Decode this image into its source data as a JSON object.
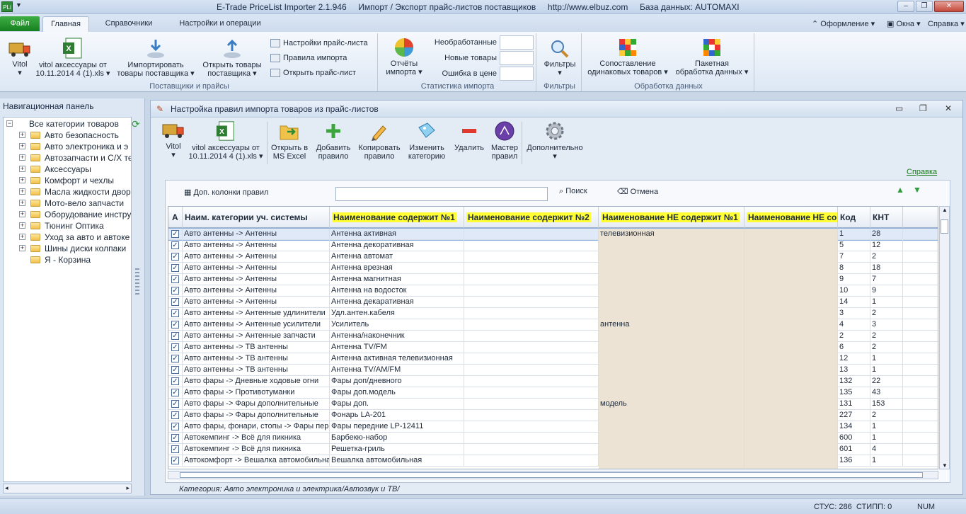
{
  "titlebar": {
    "app_icon": "PLi",
    "title": "E-Trade PriceList Importer 2.1.946     Импорт / Экспорт прайс-листов поставщиков     http://www.elbuz.com     База данных: AUTOMAXI"
  },
  "tabs": {
    "file": "Файл",
    "items": [
      "Главная",
      "Справочники",
      "Настройки и операции"
    ],
    "right": [
      "Оформление",
      "Окна",
      "Справка"
    ]
  },
  "ribbon": {
    "vitol": "Vitol",
    "file_name_1": "vitol аксессуары от",
    "file_name_2": "10.11.2014 4 (1).xls",
    "import_1": "Импортировать",
    "import_2": "товары поставщика",
    "open_1": "Открыть товары",
    "open_2": "поставщика",
    "settings_price": "Настройки прайс-листа",
    "import_rules": "Правила импорта",
    "open_price": "Открыть прайс-лист",
    "group_suppliers": "Поставщики и прайсы",
    "reports_1": "Отчёты",
    "reports_2": "импорта",
    "unprocessed": "Необработанные",
    "new_goods": "Новые товары",
    "price_error": "Ошибка в цене",
    "group_stats": "Статистика импорта",
    "filters": "Фильтры",
    "group_filters": "Фильтры",
    "compare_1": "Сопоставление",
    "compare_2": "одинаковых товаров",
    "batch_1": "Пакетная",
    "batch_2": "обработка данных",
    "group_data": "Обработка данных"
  },
  "nav": {
    "title": "Навигационная панель",
    "root": "Все категории товаров",
    "items": [
      "Авто безопасность",
      "Авто электроника и э",
      "Автозапчасти и С/Х те",
      "Аксессуары",
      "Комфорт и чехлы",
      "Масла жидкости двор",
      "Мото-вело запчасти",
      "Оборудование инстру",
      "Тюнинг  Оптика",
      "Уход за авто и автоке",
      "Шины диски колпаки",
      "Я - Корзина"
    ]
  },
  "child": {
    "title": "Настройка правил импорта товаров из прайс-листов",
    "tools": {
      "vitol": "Vitol",
      "file_1": "vitol аксессуары от",
      "file_2": "10.11.2014 4 (1).xls",
      "excel_1": "Открыть в",
      "excel_2": "MS Excel",
      "add_1": "Добавить",
      "add_2": "правило",
      "copy_1": "Копировать",
      "copy_2": "правило",
      "change_1": "Изменить",
      "change_2": "категорию",
      "delete": "Удалить",
      "wizard_1": "Мастер",
      "wizard_2": "правил",
      "extra": "Дополнительно"
    },
    "help": "Справка",
    "extra_columns": "Доп. колонки правил",
    "search_value": "",
    "search": "Поиск",
    "cancel": "Отмена",
    "footer": "Категория: Авто электроника и электрика/Автозвук и ТВ/"
  },
  "grid": {
    "headers": [
      "А",
      "Наим. категории уч. системы",
      "Наименование содержит №1",
      "Наименование содержит №2",
      "Наименование НЕ содержит №1",
      "Наименование НЕ со,",
      "Код",
      "КНТ"
    ],
    "rows": [
      [
        "Авто антенны -> Антенны",
        "Антенна активная",
        "",
        "телевизионная",
        "",
        "1",
        "28"
      ],
      [
        "Авто антенны -> Антенны",
        "Антенна декоративная",
        "",
        "",
        "",
        "5",
        "12"
      ],
      [
        "Авто антенны -> Антенны",
        "Антенна автомат",
        "",
        "",
        "",
        "7",
        "2"
      ],
      [
        "Авто антенны -> Антенны",
        "Антенна врезная",
        "",
        "",
        "",
        "8",
        "18"
      ],
      [
        "Авто антенны -> Антенны",
        "Антенна магнитная",
        "",
        "",
        "",
        "9",
        "7"
      ],
      [
        "Авто антенны -> Антенны",
        "Антенна на водосток",
        "",
        "",
        "",
        "10",
        "9"
      ],
      [
        "Авто антенны -> Антенны",
        "Антенна декаративная",
        "",
        "",
        "",
        "14",
        "1"
      ],
      [
        "Авто антенны -> Антенные удлинители",
        "Удл.антен.кабеля",
        "",
        "",
        "",
        "3",
        "2"
      ],
      [
        "Авто антенны -> Антенные усилители",
        "Усилитель",
        "",
        "антенна",
        "",
        "4",
        "3"
      ],
      [
        "Авто антенны -> Антенные запчасти",
        "Антенна/наконечник",
        "",
        "",
        "",
        "2",
        "2"
      ],
      [
        "Авто антенны -> ТВ антенны",
        "Антенна TV/FM",
        "",
        "",
        "",
        "6",
        "2"
      ],
      [
        "Авто антенны -> ТВ антенны",
        "Антенна активная телевизионная",
        "",
        "",
        "",
        "12",
        "1"
      ],
      [
        "Авто антенны -> ТВ антенны",
        "Антенна TV/AM/FM",
        "",
        "",
        "",
        "13",
        "1"
      ],
      [
        "Авто фары -> Дневные ходовые огни",
        "Фары доп/дневного",
        "",
        "",
        "",
        "132",
        "22"
      ],
      [
        "Авто фары -> Противотуманки",
        "Фары доп.модель",
        "",
        "",
        "",
        "135",
        "43"
      ],
      [
        "Авто фары -> Фары дополнительные",
        "Фары доп.",
        "",
        "модель",
        "",
        "131",
        "153"
      ],
      [
        "Авто фары -> Фары дополнительные",
        "Фонарь LA-201",
        "",
        "",
        "",
        "227",
        "2"
      ],
      [
        "Авто фары, фонари, стопы -> Фары пер",
        "Фары передние LP-12411",
        "",
        "",
        "",
        "134",
        "1"
      ],
      [
        "Автокемпинг -> Всё для пикника",
        "Барбекю-набор",
        "",
        "",
        "",
        "600",
        "1"
      ],
      [
        "Автокемпинг -> Всё для пикника",
        "Решетка-гриль",
        "",
        "",
        "",
        "601",
        "4"
      ],
      [
        "Автокомфорт -> Вешалка автомобильна",
        "Вешалка автомобильная",
        "",
        "",
        "",
        "136",
        "1"
      ]
    ]
  },
  "status": {
    "stus": "СТУС: 286",
    "stipp": "СТИПП: 0",
    "num": "NUM"
  }
}
